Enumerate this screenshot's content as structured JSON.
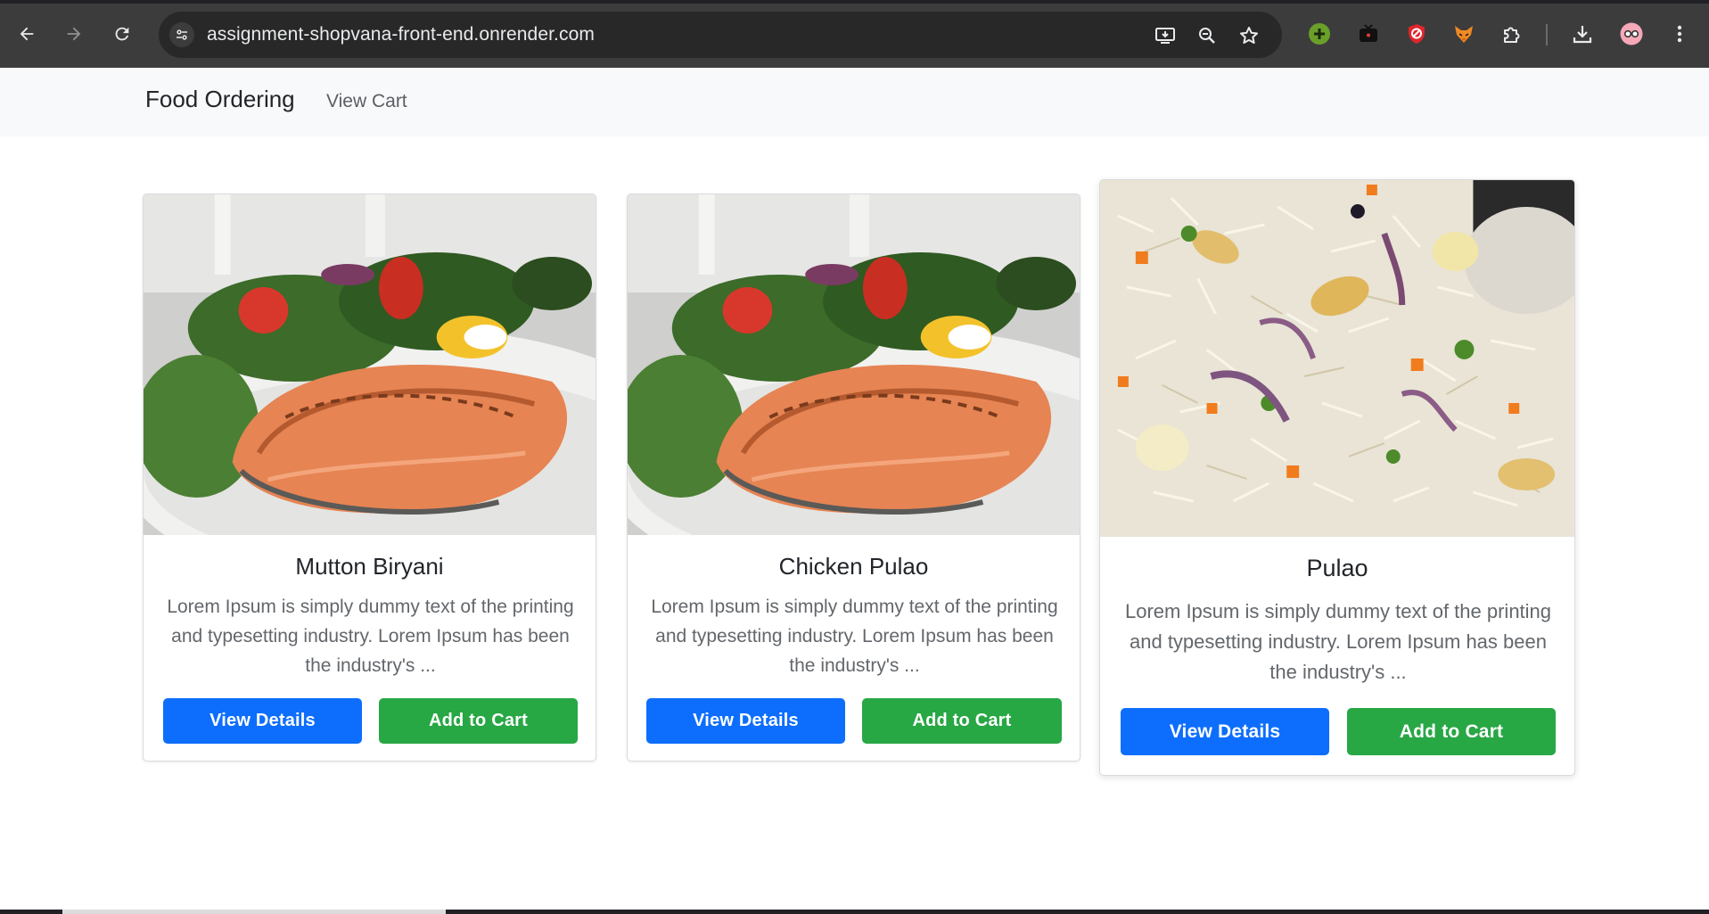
{
  "browser": {
    "url": "assignment-shopvana-front-end.onrender.com",
    "icons": [
      "back-icon",
      "forward-icon",
      "reload-icon",
      "site-settings-icon",
      "install-app-icon",
      "zoom-icon",
      "bookmark-star-icon",
      "extension-green-plus-icon",
      "extension-tv-icon",
      "extension-shield-icon",
      "extension-fox-icon",
      "extensions-puzzle-icon",
      "download-icon",
      "profile-avatar-icon",
      "menu-kebab-icon"
    ]
  },
  "navbar": {
    "brand": "Food Ordering",
    "view_cart": "View Cart"
  },
  "products": [
    {
      "name": "Mutton Biryani",
      "description": "Lorem Ipsum is simply dummy text of the printing and typesetting industry. Lorem Ipsum has been the industry's ...",
      "details_label": "View Details",
      "cart_label": "Add to Cart",
      "image": "salmon-salad-image"
    },
    {
      "name": "Chicken Pulao",
      "description": "Lorem Ipsum is simply dummy text of the printing and typesetting industry. Lorem Ipsum has been the industry's ...",
      "details_label": "View Details",
      "cart_label": "Add to Cart",
      "image": "salmon-salad-image"
    },
    {
      "name": "Pulao",
      "description": "Lorem Ipsum is simply dummy text of the printing and typesetting industry. Lorem Ipsum has been the industry's ...",
      "details_label": "View Details",
      "cart_label": "Add to Cart",
      "image": "pulao-rice-image"
    }
  ],
  "colors": {
    "primary_button": "#0d6efd",
    "success_button": "#28a745",
    "navbar_bg": "#f8f9fa",
    "chrome_bg": "#3c3c3c"
  }
}
